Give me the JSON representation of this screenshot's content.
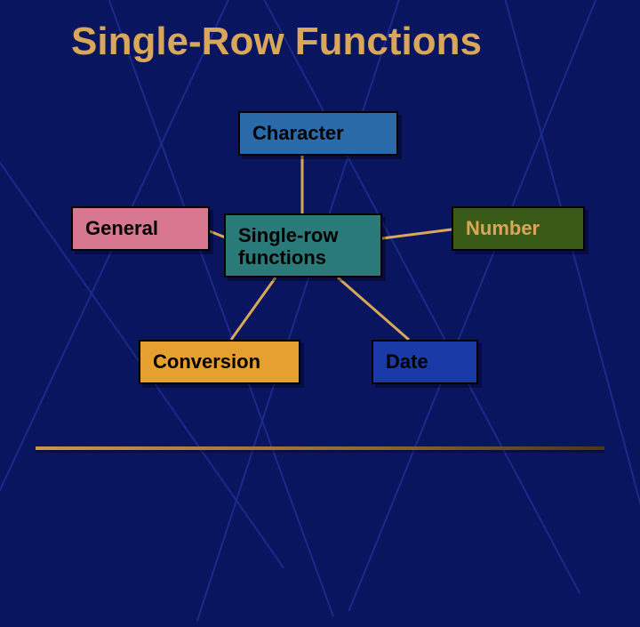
{
  "title": "Single-Row Functions",
  "nodes": {
    "character": "Character",
    "general": "General",
    "center_line1": "Single-row",
    "center_line2": "functions",
    "number": "Number",
    "conversion": "Conversion",
    "date": "Date"
  },
  "colors": {
    "background": "#0a1560",
    "title": "#d8a858",
    "connector": "#d8a858",
    "box_character": "#2a6aa8",
    "box_general": "#d87890",
    "box_center": "#2a7a7a",
    "box_number": "#3a5a18",
    "box_conversion": "#e6a030",
    "box_date": "#1a3aa8"
  }
}
